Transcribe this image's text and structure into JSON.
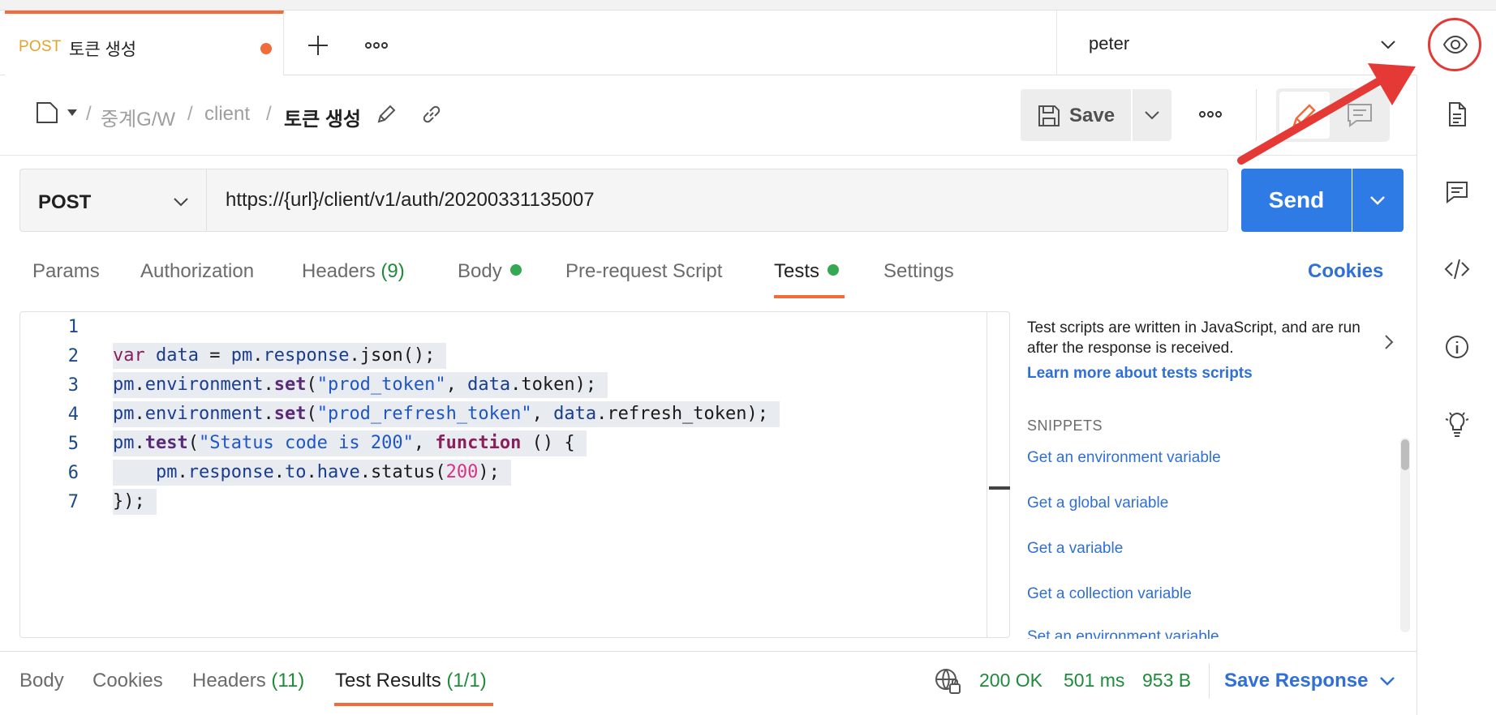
{
  "tab": {
    "method": "POST",
    "title": "토큰 생성"
  },
  "environment": {
    "name": "peter"
  },
  "breadcrumb": {
    "items": [
      "중계G/W",
      "client"
    ],
    "current": "토큰 생성",
    "separator": "/"
  },
  "toolbar": {
    "save_label": "Save"
  },
  "request": {
    "method": "POST",
    "url": "https://{url}/client/v1/auth/20200331135007",
    "send_label": "Send"
  },
  "request_tabs": [
    {
      "label": "Params"
    },
    {
      "label": "Authorization"
    },
    {
      "label": "Headers",
      "count": "(9)"
    },
    {
      "label": "Body"
    },
    {
      "label": "Pre-request Script"
    },
    {
      "label": "Tests"
    },
    {
      "label": "Settings"
    }
  ],
  "cookies_label": "Cookies",
  "editor": {
    "line_numbers": [
      "1",
      "2",
      "3",
      "4",
      "5",
      "6",
      "7"
    ],
    "lines": [
      "",
      "var data = pm.response.json();",
      "pm.environment.set(\"prod_token\", data.token);",
      "pm.environment.set(\"prod_refresh_token\", data.refresh_token);",
      "pm.test(\"Status code is 200\", function () {",
      "    pm.response.to.have.status(200);",
      "});"
    ]
  },
  "snippets_panel": {
    "description": "Test scripts are written in JavaScript, and are run after the response is received.",
    "learn_more": "Learn more about tests scripts",
    "heading": "SNIPPETS",
    "items": [
      "Get an environment variable",
      "Get a global variable",
      "Get a variable",
      "Get a collection variable",
      "Set an environment variable"
    ]
  },
  "response": {
    "tabs": [
      {
        "label": "Body"
      },
      {
        "label": "Cookies"
      },
      {
        "label": "Headers",
        "count": "(11)"
      },
      {
        "label": "Test Results",
        "count": "(1/1)"
      }
    ],
    "status": "200 OK",
    "time": "501 ms",
    "size": "953 B",
    "save_label": "Save Response"
  },
  "colors": {
    "accent": "#f26b3a",
    "primary": "#2f7be5",
    "success": "#1f8a3c",
    "link": "#2f6fd6",
    "annotation": "#e53935"
  },
  "icons": [
    "plus-icon",
    "more-icon",
    "chevron-down-icon",
    "eye-icon",
    "collection-icon",
    "pencil-icon",
    "link-icon",
    "save-icon",
    "comment-icon",
    "document-icon",
    "code-icon",
    "info-icon",
    "lightbulb-icon",
    "globe-icon",
    "chevron-right-icon"
  ]
}
